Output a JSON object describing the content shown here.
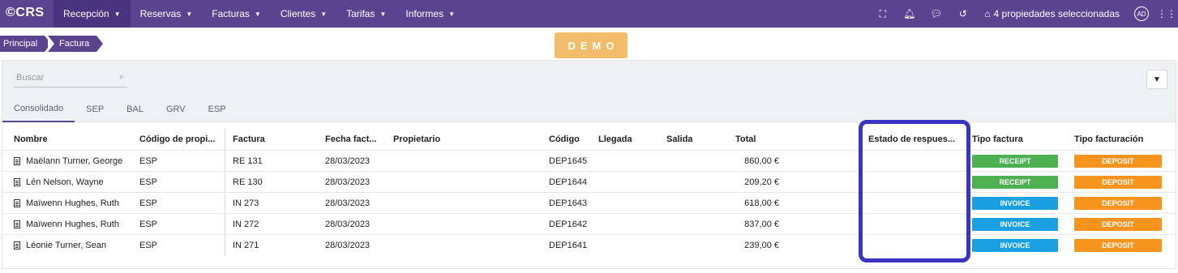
{
  "app": {
    "logo": "©CRS"
  },
  "nav": [
    {
      "label": "Recepción"
    },
    {
      "label": "Reservas"
    },
    {
      "label": "Facturas"
    },
    {
      "label": "Clientes"
    },
    {
      "label": "Tarifas"
    },
    {
      "label": "Informes"
    }
  ],
  "topright": {
    "properties": "4 propiedades seleccionadas",
    "avatar": "AD"
  },
  "breadcrumb": [
    "Principal",
    "Factura"
  ],
  "demo": "DEMO",
  "search": {
    "placeholder": "Buscar"
  },
  "tabs": [
    "Consolidado",
    "SEP",
    "BAL",
    "GRV",
    "ESP"
  ],
  "columns": {
    "name": "Nombre",
    "property": "Código de propi...",
    "invoice": "Factura",
    "date": "Fecha fact...",
    "owner": "Propietario",
    "code": "Código",
    "arrival": "Llegada",
    "departure": "Salida",
    "total": "Total",
    "status": "Estado de respues...",
    "invoice_type": "Tipo factura",
    "billing_type": "Tipo facturación"
  },
  "rows": [
    {
      "name": "Maëlann Turner, George",
      "property": "ESP",
      "invoice": "RE 131",
      "date": "28/03/2023",
      "code": "DEP1645",
      "total": "860,00 €",
      "invoice_type": "RECEIPT",
      "billing_type": "DEPOSIT"
    },
    {
      "name": "Lén Nelson, Wayne",
      "property": "ESP",
      "invoice": "RE 130",
      "date": "28/03/2023",
      "code": "DEP1644",
      "total": "209,20 €",
      "invoice_type": "RECEIPT",
      "billing_type": "DEPOSIT"
    },
    {
      "name": "Maïwenn Hughes, Ruth",
      "property": "ESP",
      "invoice": "IN 273",
      "date": "28/03/2023",
      "code": "DEP1643",
      "total": "618,00 €",
      "invoice_type": "INVOICE",
      "billing_type": "DEPOSIT"
    },
    {
      "name": "Maïwenn Hughes, Ruth",
      "property": "ESP",
      "invoice": "IN 272",
      "date": "28/03/2023",
      "code": "DEP1642",
      "total": "837,00 €",
      "invoice_type": "INVOICE",
      "billing_type": "DEPOSIT"
    },
    {
      "name": "Léonie Turner, Sean",
      "property": "ESP",
      "invoice": "IN 271",
      "date": "28/03/2023",
      "code": "DEP1641",
      "total": "239,00 €",
      "invoice_type": "INVOICE",
      "billing_type": "DEPOSIT"
    }
  ],
  "colors": {
    "brand": "#5b4390",
    "receipt": "#4caf50",
    "invoice": "#1a9fe0",
    "deposit": "#f7941d",
    "highlight": "#3a34c4",
    "demo": "#f2bc6a"
  },
  "icons": {
    "fullscreen": "fullscreen-icon",
    "bell": "bell-icon",
    "chat": "chat-icon",
    "history": "history-icon",
    "home": "home-icon",
    "apps": "apps-grid-icon",
    "search": "search-icon",
    "filter": "filter-icon",
    "document": "document-icon"
  }
}
